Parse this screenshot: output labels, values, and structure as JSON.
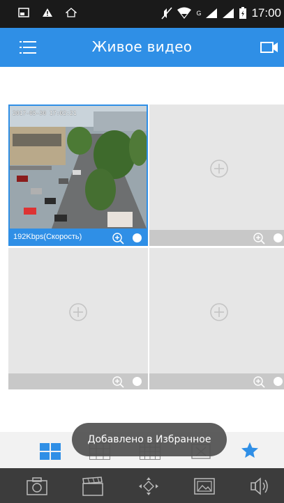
{
  "status_bar": {
    "time": "17:00",
    "network_label": "G"
  },
  "app_bar": {
    "title": "Живое видео"
  },
  "grid": {
    "cells": [
      {
        "id": "cell-1",
        "speed": "192Kbps(Скорость)",
        "osd_time": "2017-05-30 17:02:21"
      },
      {
        "id": "cell-2"
      },
      {
        "id": "cell-3"
      },
      {
        "id": "cell-4"
      }
    ]
  },
  "toast": {
    "message": "Добавлено в Избранное"
  },
  "colors": {
    "accent": "#2f8fe6",
    "status_bar": "#1a1a1a",
    "bottom_bar": "#3c3c3c"
  },
  "icons": {
    "app_bar": [
      "menu-icon",
      "camera-switch-icon"
    ],
    "fav_bar": [
      "layout-4-icon",
      "layout-9-icon",
      "layout-16-icon",
      "close-all-icon",
      "favorite-star-icon"
    ],
    "bottom_bar": [
      "snapshot-icon",
      "record-icon",
      "ptz-icon",
      "gallery-icon",
      "sound-icon"
    ]
  }
}
